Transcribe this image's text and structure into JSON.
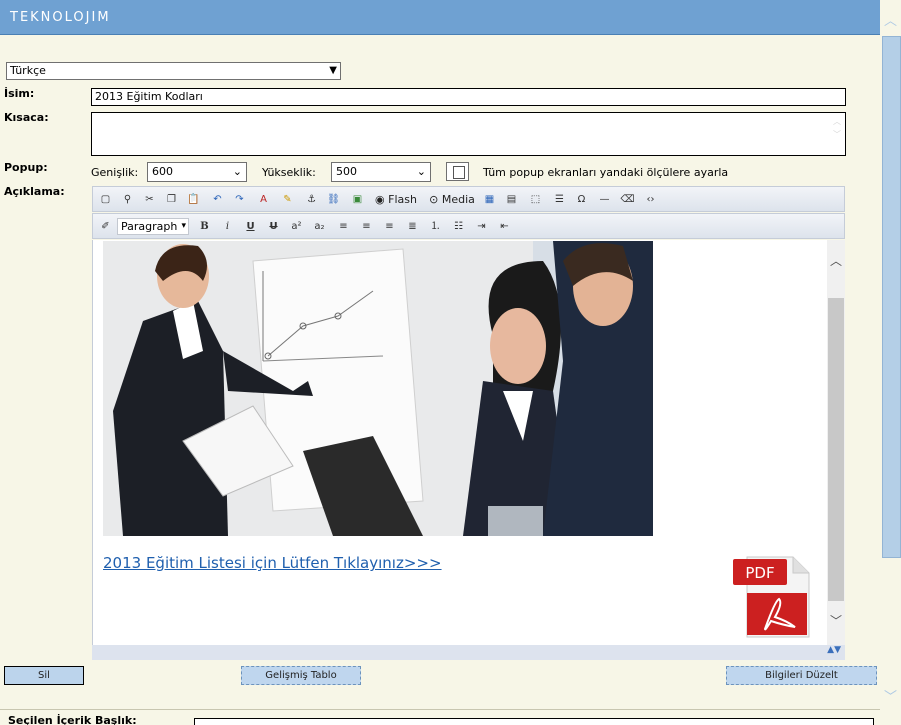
{
  "header": {
    "logo_text": "TEKNOLOJIM"
  },
  "language_select": {
    "value": "Türkçe"
  },
  "form": {
    "name_label": "İsim:",
    "name_value": "2013 Eğitim Kodları",
    "summary_label": "Kısaca:",
    "summary_value": "",
    "popup_label": "Popup:",
    "width_label": "Genişlik:",
    "width_value": "600",
    "height_label": "Yükseklik:",
    "height_value": "500",
    "popup_checkbox_label": "Tüm popup ekranları yandaki ölçülere ayarla",
    "description_label": "Açıklama:"
  },
  "toolbar": {
    "flash_label": "Flash",
    "media_label": "Media",
    "format_select": "Paragraph",
    "bold": "B",
    "italic": "i",
    "underline": "U",
    "strike": "U",
    "superscript": "a²",
    "subscript": "a₂"
  },
  "editor": {
    "link_text": "2013 Eğitim Listesi için Lütfen Tıklayınız>>>",
    "pdf_label": "PDF"
  },
  "buttons": {
    "delete": "Sil",
    "advanced_table": "Gelişmiş Tablo",
    "edit_info": "Bilgileri Düzelt"
  },
  "bottom": {
    "selected_content_title_label": "Seçilen İçerik Başlık:"
  },
  "colors": {
    "header": "#6fa1d2",
    "page_bg": "#f7f6e7",
    "link": "#1f5fae",
    "button": "#bfd6ee",
    "pdf_red": "#cc2020"
  },
  "icons": [
    "source-icon",
    "find-icon",
    "cut-icon",
    "copy-icon",
    "paste-icon",
    "undo-icon",
    "redo-icon",
    "text-color-icon",
    "highlight-icon",
    "anchor-icon",
    "link-icon",
    "image-icon",
    "flash-icon",
    "media-icon",
    "table-icon",
    "table-props-icon",
    "grid-icon",
    "rule-icon",
    "omega-icon",
    "hr-icon",
    "eraser-icon",
    "code-icon"
  ]
}
